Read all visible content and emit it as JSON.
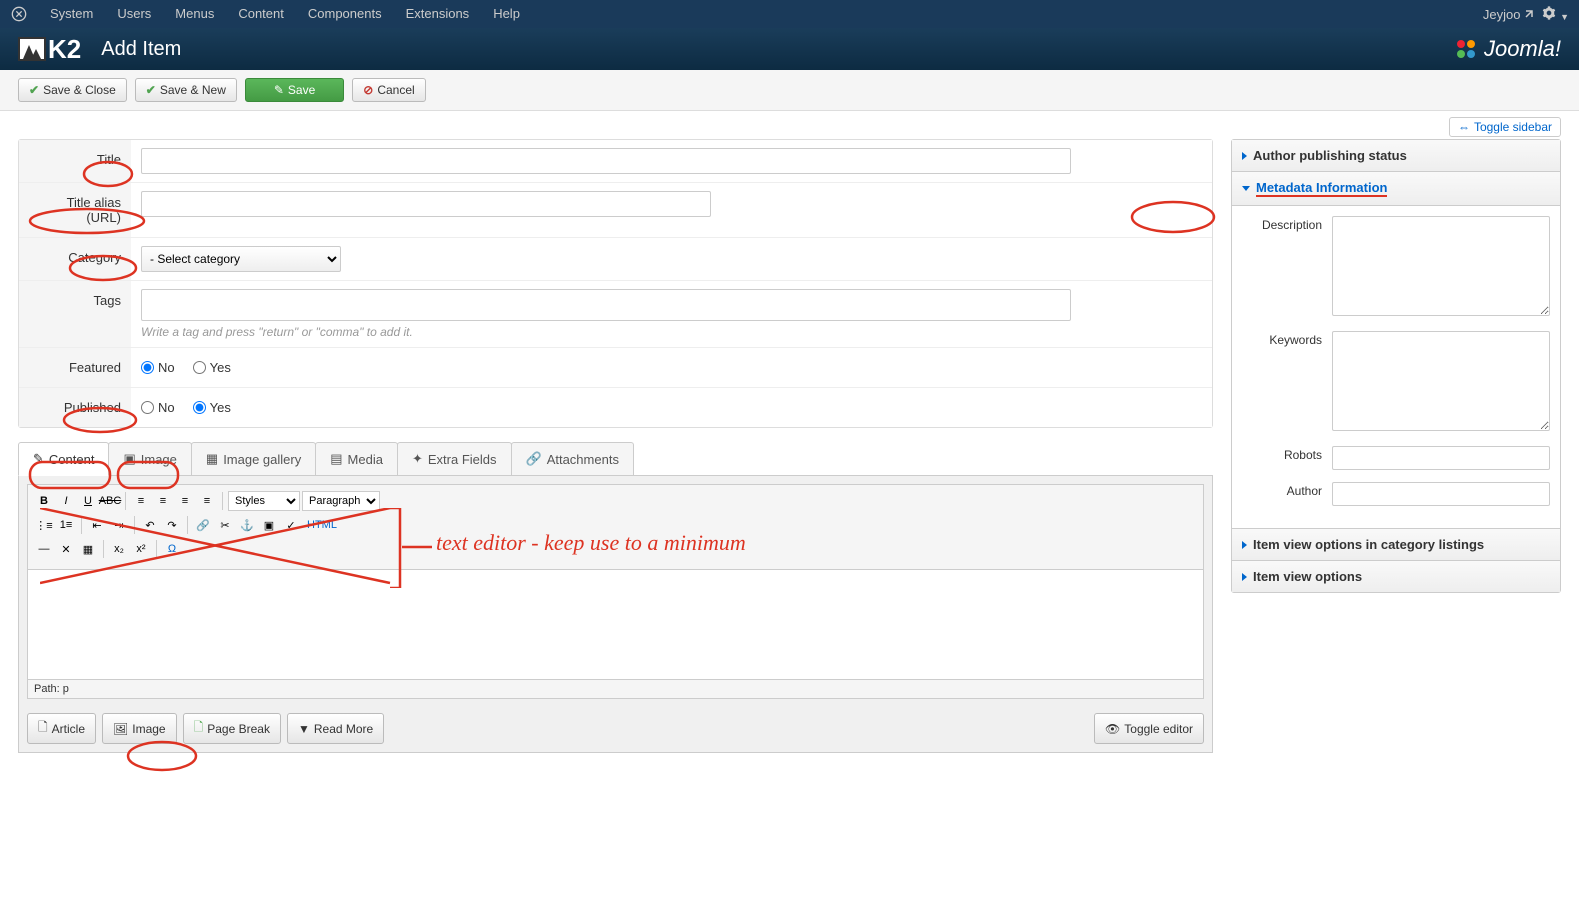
{
  "topnav": {
    "items": [
      "System",
      "Users",
      "Menus",
      "Content",
      "Components",
      "Extensions",
      "Help"
    ],
    "user": "Jeyjoo"
  },
  "header": {
    "logo_text": "K2",
    "page_title": "Add Item",
    "brand": "Joomla!"
  },
  "toolbar": {
    "save_close": "Save & Close",
    "save_new": "Save & New",
    "save": "Save",
    "cancel": "Cancel"
  },
  "toggle_sidebar": "Toggle sidebar",
  "form": {
    "title_label": "Title",
    "alias_label": "Title alias (URL)",
    "category_label": "Category",
    "category_placeholder": "- Select category",
    "tags_label": "Tags",
    "tags_hint": "Write a tag and press \"return\" or \"comma\" to add it.",
    "featured_label": "Featured",
    "published_label": "Published",
    "no": "No",
    "yes": "Yes"
  },
  "tabs": {
    "content": "Content",
    "image": "Image",
    "gallery": "Image gallery",
    "media": "Media",
    "extra": "Extra Fields",
    "attachments": "Attachments"
  },
  "editor": {
    "styles_select": "Styles",
    "paragraph_select": "Paragraph",
    "html_btn": "HTML",
    "path": "Path: p",
    "btn_article": "Article",
    "btn_image": "Image",
    "btn_pagebreak": "Page Break",
    "btn_readmore": "Read More",
    "btn_toggle": "Toggle editor"
  },
  "sidebar": {
    "author_status": "Author publishing status",
    "metadata": "Metadata Information",
    "description": "Description",
    "keywords": "Keywords",
    "robots": "Robots",
    "author": "Author",
    "item_view_cat": "Item view options in category listings",
    "item_view": "Item view options"
  },
  "annotation": {
    "text": "text editor - keep use to a minimum"
  }
}
